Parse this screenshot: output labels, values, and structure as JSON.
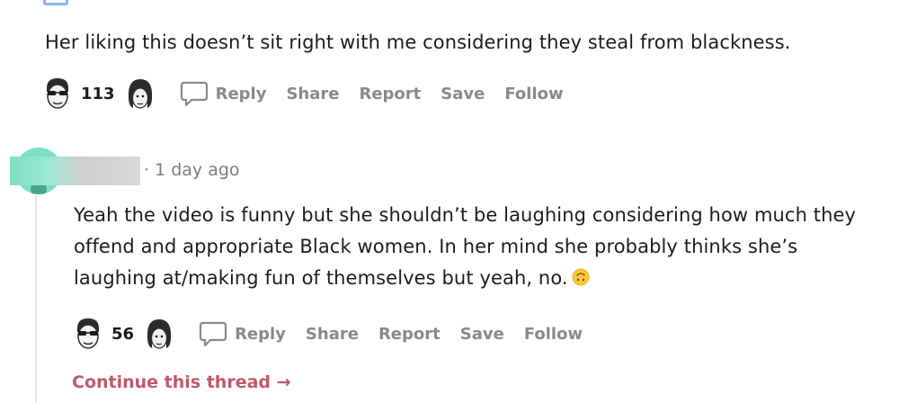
{
  "comment1": {
    "text": "Her liking this doesn’t sit right with me considering they steal from blackness.",
    "score": "113",
    "actions": {
      "reply": "Reply",
      "share": "Share",
      "report": "Report",
      "save": "Save",
      "follow": "Follow"
    }
  },
  "comment2": {
    "meta": "· 1 day ago",
    "text": "Yeah the video is funny but she shouldn’t be laughing considering how much they offend and appropriate Black women. In her mind she probably thinks she’s laughing at/making fun of themselves but yeah, no.",
    "emoji_icon": "upside-down-face-emoji",
    "score": "56",
    "actions": {
      "reply": "Reply",
      "share": "Share",
      "report": "Report",
      "save": "Save",
      "follow": "Follow"
    }
  },
  "continue_thread": "Continue this thread →",
  "colors": {
    "action_gray": "#878a8c",
    "continue_link": "#c0586a",
    "avatar_teal": "#7ee0c4"
  }
}
